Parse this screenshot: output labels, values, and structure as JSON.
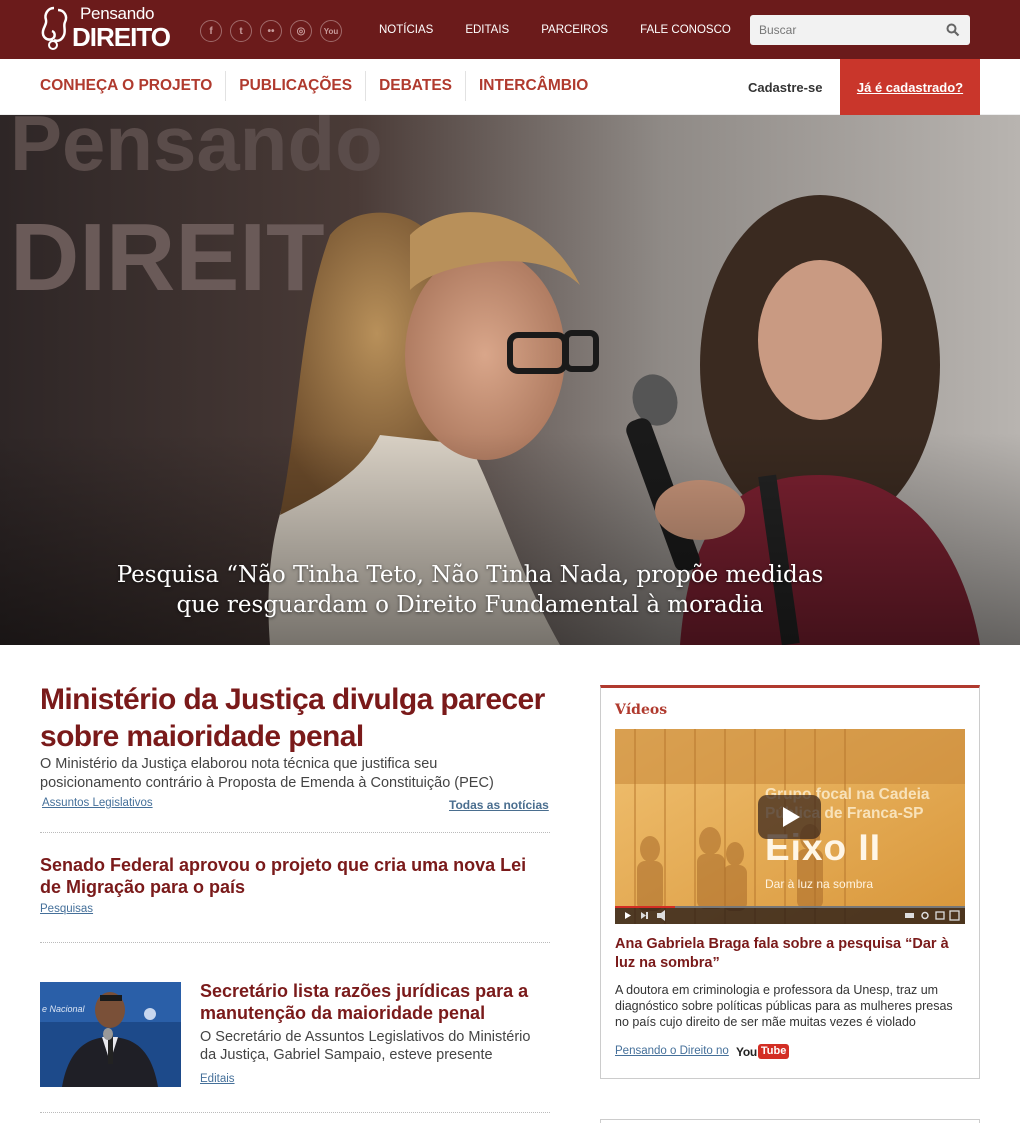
{
  "brand": {
    "logo_line1": "Pensando",
    "logo_line2": "DIREITO"
  },
  "social": [
    {
      "icon": "facebook-icon",
      "glyph": "f"
    },
    {
      "icon": "twitter-icon",
      "glyph": "t"
    },
    {
      "icon": "flickr-icon",
      "glyph": "••"
    },
    {
      "icon": "github-icon",
      "glyph": "◎"
    },
    {
      "icon": "youtube-icon",
      "glyph": "You"
    }
  ],
  "topnav": [
    "NOTÍCIAS",
    "EDITAIS",
    "PARCEIROS",
    "FALE CONOSCO"
  ],
  "search": {
    "placeholder": "Buscar"
  },
  "mainnav": [
    "CONHEÇA O PROJETO",
    "PUBLICAÇÕES",
    "DEBATES",
    "INTERCÂMBIO"
  ],
  "account": {
    "signup": "Cadastre-se",
    "login": "Já é cadastrado?"
  },
  "hero": {
    "caption_line1": "Pesquisa “Não Tinha Teto, Não Tinha Nada, propõe medidas",
    "caption_line2": "que resguardam o Direito Fundamental à moradia"
  },
  "lead": {
    "title": "Ministério da Justiça divulga parecer sobre maioridade penal",
    "description": "O Ministério da Justiça elaborou nota técnica que justifica seu posicionamento contrário à Proposta de Emenda à Constituição (PEC)",
    "tag": "Assuntos Legislativos",
    "all_news": "Todas as notícias"
  },
  "news": [
    {
      "title": "Senado Federal aprovou  o projeto que cria uma nova Lei de Migração para o país",
      "tag": "Pesquisas"
    },
    {
      "title": "Secretário lista razões jurídicas para a manutenção da maioridade penal",
      "description": "O Secretário de Assuntos Legislativos do Ministério da Justiça, Gabriel Sampaio, esteve presente",
      "tag": "Editais"
    }
  ],
  "videos": {
    "heading": "Vídeos",
    "overlay_line1": "Grupo focal na Cadeia",
    "overlay_line2": "Pública de Franca-SP",
    "overlay_title": "Eixo II",
    "overlay_sub": "Dar à luz na sombra",
    "headline": "Ana Gabriela Braga fala sobre a pesquisa “Dar à luz na sombra”",
    "description": "A doutora em criminologia e professora da Unesp, traz um diagnóstico sobre políticas públicas para as  mulheres presas no país cujo direito de ser mãe muitas vezes é violado",
    "channel": "Pensando o Direito no",
    "yt_you": "You",
    "yt_tube": "Tube"
  },
  "colors": {
    "brand": "#6b1b1b",
    "accent": "#c9362b",
    "title": "#7a1a1a",
    "link": "#45709a"
  }
}
